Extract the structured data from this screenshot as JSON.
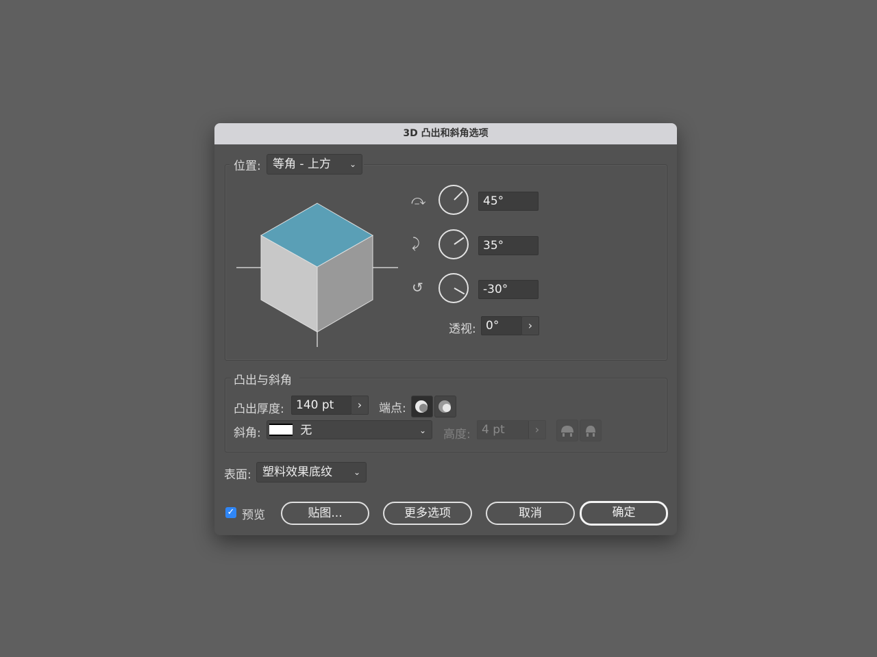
{
  "dialog": {
    "title": "3D 凸出和斜角选项"
  },
  "position": {
    "label": "位置:",
    "value": "等角 - 上方",
    "rotation_x": "45°",
    "rotation_y": "35°",
    "rotation_z": "-30°",
    "perspective_label": "透视:",
    "perspective_value": "0°"
  },
  "extrude": {
    "section_label": "凸出与斜角",
    "depth_label": "凸出厚度:",
    "depth_value": "140 pt",
    "cap_label": "端点:",
    "bevel_label": "斜角:",
    "bevel_value": "无",
    "height_label": "高度:",
    "height_value": "4 pt"
  },
  "surface": {
    "label": "表面:",
    "value": "塑料效果底纹"
  },
  "footer": {
    "preview_label": "预览",
    "map_button": "贴图...",
    "more_button": "更多选项",
    "cancel_button": "取消",
    "ok_button": "确定"
  },
  "colors": {
    "cube_top": "#5a9fb6",
    "cube_left": "#c8c8c8",
    "cube_right": "#999999",
    "accent": "#2f86f6"
  }
}
